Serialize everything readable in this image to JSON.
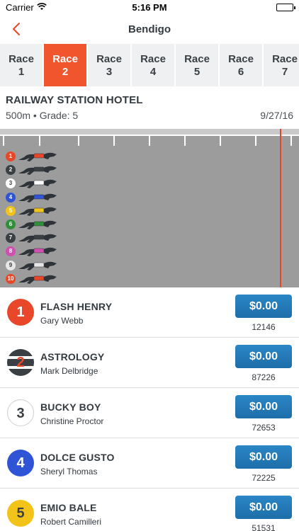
{
  "status": {
    "carrier": "Carrier",
    "time": "5:16 PM"
  },
  "nav": {
    "title": "Bendigo"
  },
  "race_tabs": [
    {
      "line1": "Race",
      "line2": "1"
    },
    {
      "line1": "Race",
      "line2": "2"
    },
    {
      "line1": "Race",
      "line2": "3"
    },
    {
      "line1": "Race",
      "line2": "4"
    },
    {
      "line1": "Race",
      "line2": "5"
    },
    {
      "line1": "Race",
      "line2": "6"
    },
    {
      "line1": "Race",
      "line2": "7"
    }
  ],
  "active_tab_index": 1,
  "race": {
    "name": "RAILWAY STATION HOTEL",
    "meta": "500m • Grade: 5",
    "date": "9/27/16"
  },
  "colors": {
    "accent": "#f0552e",
    "bet_button": "#2277b8",
    "finish_line": "#e2472a",
    "track": "#9c9c9c"
  },
  "track_dogs": [
    {
      "number": "1",
      "color": "#e8472a"
    },
    {
      "number": "2",
      "color": "#3a3f44"
    },
    {
      "number": "3",
      "color": "#ffffff"
    },
    {
      "number": "4",
      "color": "#2f55d6"
    },
    {
      "number": "5",
      "color": "#f2c318"
    },
    {
      "number": "6",
      "color": "#2f8f3a"
    },
    {
      "number": "7",
      "color": "#3a3f44"
    },
    {
      "number": "8",
      "color": "#d04fb0"
    },
    {
      "number": "9",
      "color": "#e6e6e6"
    },
    {
      "number": "10",
      "color": "#e8472a"
    }
  ],
  "runners": [
    {
      "number": "1",
      "name": "FLASH HENRY",
      "trainer": "Gary Webb",
      "bet": "$0.00",
      "id": "12146",
      "badge_color": "#e8472a",
      "badge_text_color": "#ffffff"
    },
    {
      "number": "2",
      "name": "ASTROLOGY",
      "trainer": "Mark Delbridge",
      "bet": "$0.00",
      "id": "87226",
      "badge_color": "#3a3f44",
      "badge_text_color": "#e8472a"
    },
    {
      "number": "3",
      "name": "BUCKY BOY",
      "trainer": "Christine Proctor",
      "bet": "$0.00",
      "id": "72653",
      "badge_color": "#ffffff",
      "badge_text_color": "#3a3f44"
    },
    {
      "number": "4",
      "name": "DOLCE GUSTO",
      "trainer": "Sheryl Thomas",
      "bet": "$0.00",
      "id": "72225",
      "badge_color": "#2f55d6",
      "badge_text_color": "#ffffff"
    },
    {
      "number": "5",
      "name": "EMIO BALE",
      "trainer": "Robert Camilleri",
      "bet": "$0.00",
      "id": "51531",
      "badge_color": "#f2c318",
      "badge_text_color": "#3a3f44"
    }
  ]
}
